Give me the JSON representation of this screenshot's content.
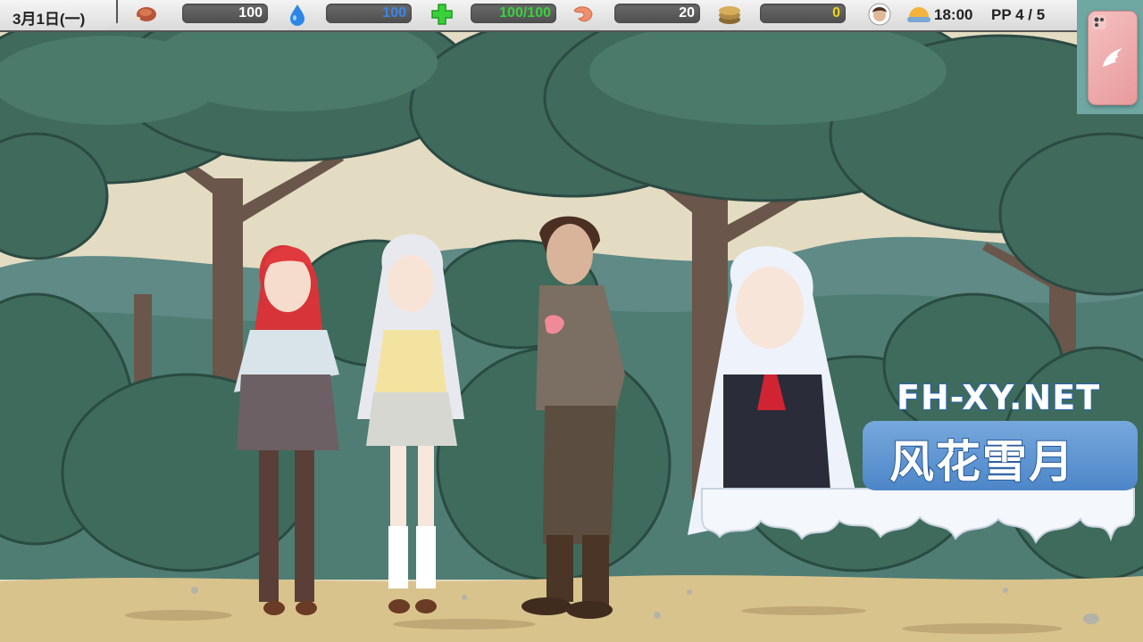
{
  "hud": {
    "date": "3月1日(一)",
    "stats": [
      {
        "name": "hunger",
        "icon": "roast-meat-icon",
        "value": "100",
        "color": "#ffffff"
      },
      {
        "name": "thirst",
        "icon": "water-drop-icon",
        "value": "100",
        "color": "#3a86e8"
      },
      {
        "name": "health",
        "icon": "green-cross-icon",
        "value": "100/100",
        "color": "#37d23a"
      },
      {
        "name": "shrimp",
        "icon": "shrimp-icon",
        "value": "20",
        "color": "#ffffff"
      },
      {
        "name": "coins",
        "icon": "coin-stack-icon",
        "value": "0",
        "color": "#f2d21a"
      }
    ],
    "avatar_icon": "player-avatar-icon",
    "time_icon": "sunrise-icon",
    "time": "18:00",
    "pp": "PP 4 / 5"
  },
  "phone": {
    "icon": "wing-icon"
  },
  "characters": [
    "red-haired-girl",
    "silver-haired-girl",
    "brown-haired-man"
  ],
  "watermark": {
    "url": "FH-XY.NET",
    "brand": "风花雪月"
  }
}
